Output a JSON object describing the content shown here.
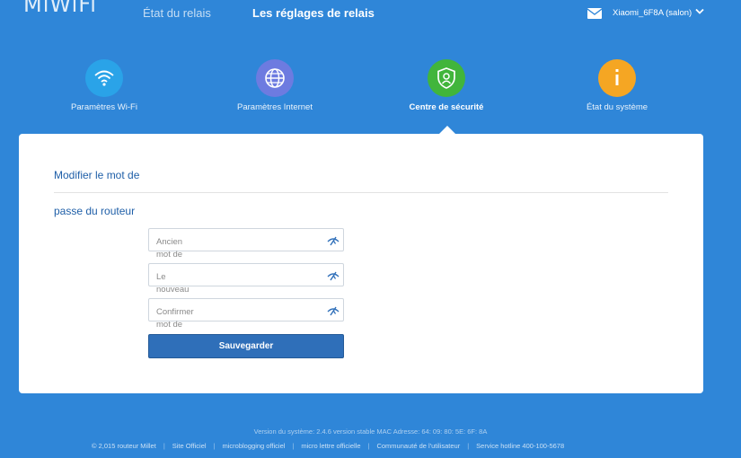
{
  "header": {
    "logo": "MiWiFi",
    "nav_status": "État du relais",
    "nav_settings": "Les réglages de relais",
    "device_name": "Xiaomi_6F8A (salon)"
  },
  "nav_items": [
    {
      "label": "Paramètres Wi-Fi",
      "icon": "wifi-icon",
      "color": "#2aa3e8"
    },
    {
      "label": "Paramètres Internet",
      "icon": "globe-icon",
      "color": "#6d7be0"
    },
    {
      "label": "Centre de sécurité",
      "icon": "shield-icon",
      "color": "#41b53b"
    },
    {
      "label": "État du système",
      "icon": "info-icon",
      "color": "#f5a623"
    }
  ],
  "card": {
    "title_line1": "Modifier le mot de",
    "title_line2": "passe du routeur",
    "fields": [
      {
        "placeholder": "Ancien",
        "placeholder_more": "mot de"
      },
      {
        "placeholder": "Le",
        "placeholder_more": "nouveau"
      },
      {
        "placeholder": "Confirmer",
        "placeholder_more": "mot de"
      }
    ],
    "save_label": "Sauvegarder"
  },
  "footer": {
    "version": "Version du système: 2.4.6 version stable MAC Adresse: 64: 09: 80: 5E: 6F: 8A",
    "links": [
      "© 2,015 routeur Millet",
      "Site Officiel",
      "microblogging officiel",
      "micro lettre officielle",
      "Communauté de l'utilisateur",
      "Service hotline 400-100-5678"
    ]
  }
}
